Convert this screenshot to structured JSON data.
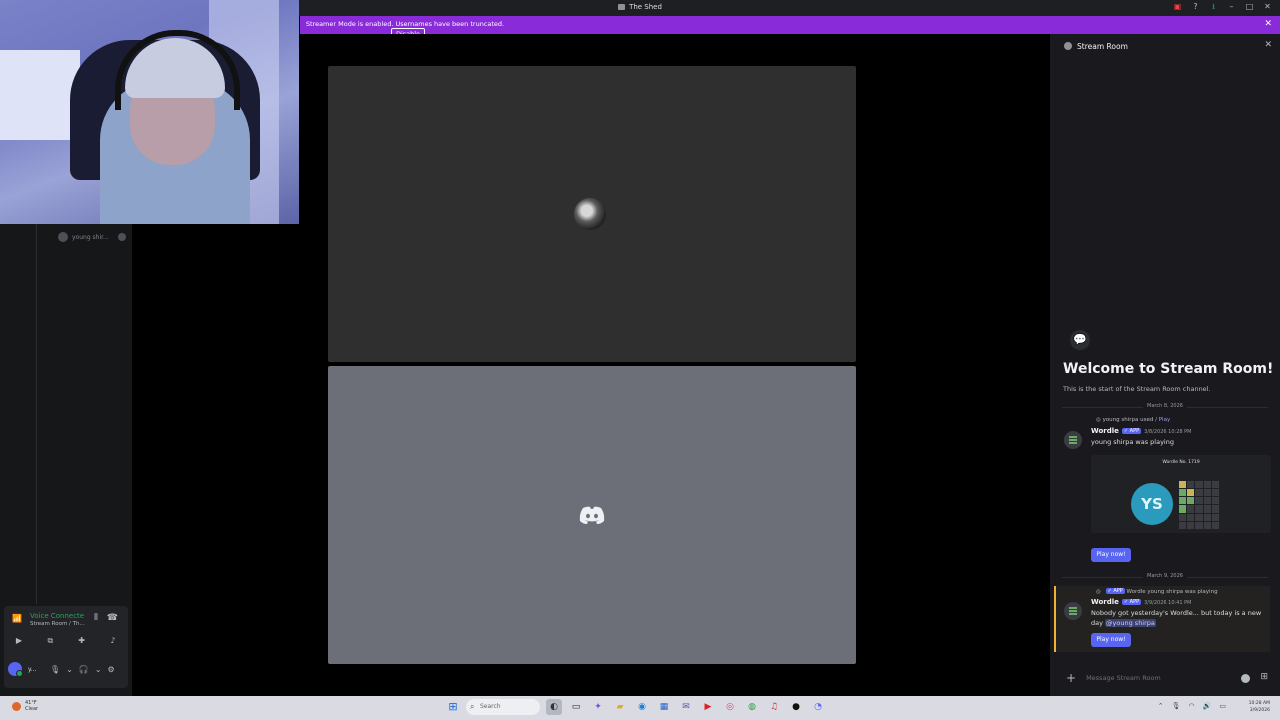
{
  "window": {
    "title": "The Shed"
  },
  "banner": {
    "message": "Streamer Mode is enabled. Usernames have been truncated.",
    "button": "Disable"
  },
  "sidebar": {
    "member": "young shir...",
    "voice": {
      "status": "Voice Connected",
      "channel": "Stream Room / Th..."
    },
    "user": {
      "name": "y..."
    }
  },
  "chat": {
    "channel": "Stream Room",
    "welcome_title": "Welcome to Stream Room!",
    "welcome_sub": "This is the start of the Stream Room channel.",
    "date1": "March 8, 2026",
    "date2": "March 9, 2026",
    "msg1": {
      "reply_user": "young shirpa",
      "reply_text": "used",
      "reply_cmd": "/ Play",
      "author": "Wordle",
      "tag": "✓ APP",
      "time": "3/8/2026 10:28 PM",
      "body": "young shirpa was playing",
      "embed_caption": "Wordle No. 1719",
      "avatar_text": "YS",
      "button": "Play now!"
    },
    "msg2": {
      "reply_tag": "✓ APP",
      "reply_text": "Wordle young shirpa was playing",
      "author": "Wordle",
      "tag": "✓ APP",
      "time": "3/9/2026 10:41 PM",
      "body": "Nobody got yesterday's Wordle... but today is a new day",
      "mention": "@young shirpa",
      "button": "Play now!"
    },
    "composer_placeholder": "Message Stream Room"
  },
  "taskbar": {
    "weather_temp": "41°F",
    "weather_desc": "Clear",
    "search": "Search",
    "time": "10:28 AM",
    "date": "3/9/2026"
  },
  "colors": {
    "accent": "#5865f2",
    "banner": "#8a2bd9",
    "connected": "#23a559"
  }
}
